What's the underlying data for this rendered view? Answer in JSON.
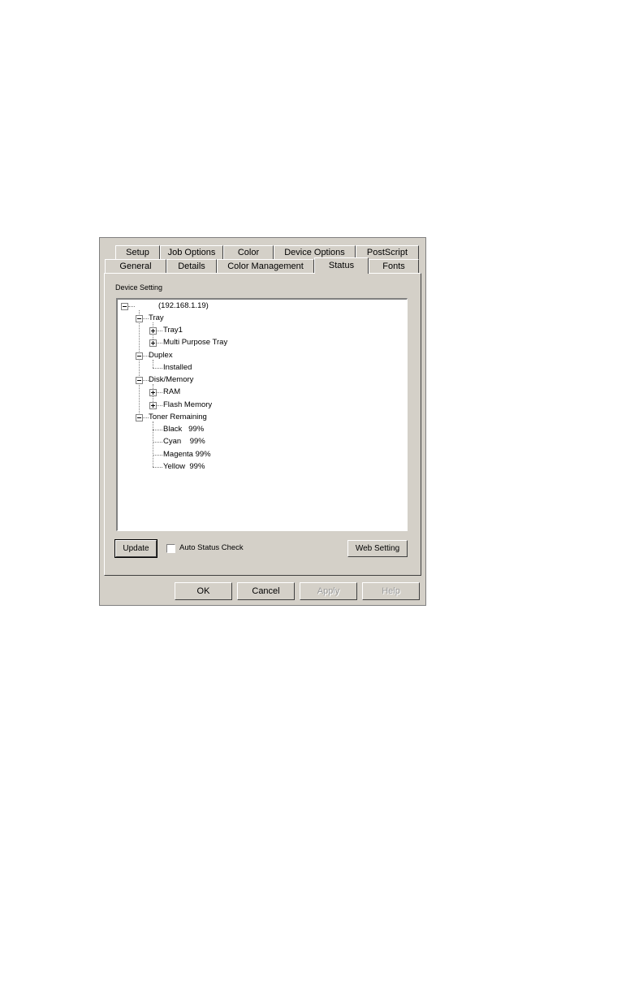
{
  "tabs_row1": [
    "Setup",
    "Job Options",
    "Color",
    "Device Options",
    "PostScript"
  ],
  "tabs_row2": [
    "General",
    "Details",
    "Color Management",
    "Status",
    "Fonts"
  ],
  "active_tab": "Status",
  "group_label": "Device Setting",
  "tree": {
    "root": "(192.168.1.19)",
    "tray": "Tray",
    "tray1": "Tray1",
    "multi_purpose_tray": "Multi Purpose Tray",
    "duplex": "Duplex",
    "installed": "Installed",
    "disk_memory": "Disk/Memory",
    "ram": "RAM",
    "flash_memory": "Flash Memory",
    "toner_remaining": "Toner Remaining",
    "black": "Black   99%",
    "cyan": "Cyan    99%",
    "magenta": "Magenta 99%",
    "yellow": "Yellow  99%"
  },
  "buttons": {
    "update": "Update",
    "auto_status_check": "Auto Status Check",
    "web_setting": "Web Setting",
    "ok": "OK",
    "cancel": "Cancel",
    "apply": "Apply",
    "help": "Help"
  }
}
